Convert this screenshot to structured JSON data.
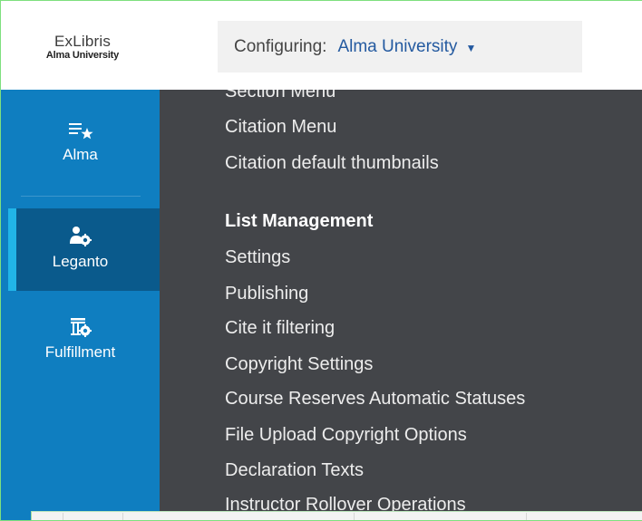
{
  "header": {
    "logo_main": "ExLibris",
    "logo_sub": "Alma University",
    "config_label": "Configuring:",
    "config_value": "Alma University",
    "config_caret": "▼"
  },
  "sidebar": {
    "items": [
      {
        "label": "Alma",
        "icon": "list-star-icon"
      },
      {
        "label": "Leganto",
        "icon": "user-gear-icon",
        "active": true
      },
      {
        "label": "Fulfillment",
        "icon": "shelf-gear-icon"
      }
    ]
  },
  "menu": {
    "items": [
      {
        "label": "Section Menu"
      },
      {
        "label": "Citation Menu"
      },
      {
        "label": "Citation default thumbnails"
      },
      {
        "label": "List Management",
        "heading": true
      },
      {
        "label": "Settings"
      },
      {
        "label": "Publishing"
      },
      {
        "label": "Cite it filtering"
      },
      {
        "label": "Copyright Settings"
      },
      {
        "label": "Course Reserves Automatic Statuses"
      },
      {
        "label": "File Upload Copyright Options"
      },
      {
        "label": "Declaration Texts"
      },
      {
        "label": "Instructor Rollover Operations"
      }
    ]
  },
  "colors": {
    "sidebar": "#0f7ec0",
    "sidebar_active": "#0a5a8c",
    "active_bar": "#21b5e8",
    "panel": "#434549",
    "accent": "#245aa0"
  }
}
